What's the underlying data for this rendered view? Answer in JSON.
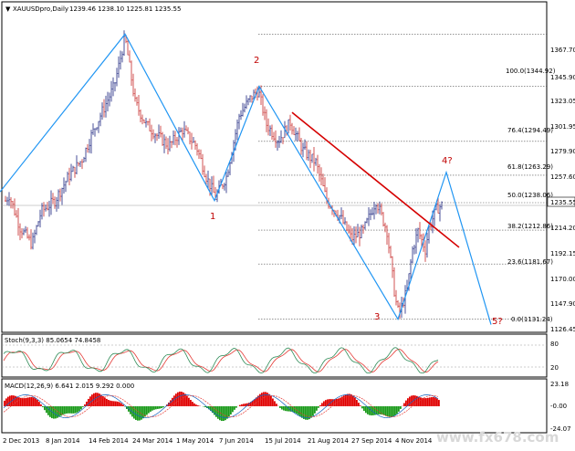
{
  "header": {
    "triangle": "▼",
    "symbol": "XAUUSDpro,Daily",
    "ohlc": "1239.46 1238.10 1225.81 1235.55"
  },
  "price_axis": {
    "ticks": [
      "1367.70",
      "1345.90",
      "1323.05",
      "1301.95",
      "1279.90",
      "1257.60",
      "1235.55",
      "1214.20",
      "1192.15",
      "1170.00",
      "1147.90",
      "1126.45"
    ],
    "current_price": "1235.55"
  },
  "fibonacci": {
    "levels": [
      {
        "label": "100.0(1344.92)"
      },
      {
        "label": "76.4(1294.49)"
      },
      {
        "label": "61.8(1263.29)"
      },
      {
        "label": "50.0(1238.06)"
      },
      {
        "label": "38.2(1212.86)"
      },
      {
        "label": "23.6(1181.67)"
      },
      {
        "label": "0.0(1131.24)"
      }
    ]
  },
  "wave_labels": {
    "w1": "1",
    "w2": "2",
    "w3": "3",
    "w4": "4?",
    "w5": "5?"
  },
  "stoch": {
    "title": "Stoch(9,3,3) 85.0654 74.8458",
    "ticks": [
      "80",
      "20"
    ]
  },
  "macd": {
    "title": "MACD(12,26,9) 6.641 2.015 9.292 0.000",
    "ticks": [
      "23.18",
      "-0.00",
      "-24.07"
    ]
  },
  "time_axis": {
    "labels": [
      "2 Dec 2013",
      "8 Jan 2014",
      "14 Feb 2014",
      "24 Mar 2014",
      "1 May 2014",
      "7 Jun 2014",
      "15 Jul 2014",
      "21 Aug 2014",
      "27 Sep 2014",
      "4 Nov 2014"
    ]
  },
  "watermark": "www.fx678.com",
  "colors": {
    "bull": "#1a237e",
    "bear": "#c62828",
    "wave": "#2196f3",
    "trend": "#d50000",
    "stochK": "#2e8b57",
    "stochD": "#e53935",
    "macdPos": "#e00000",
    "macdNeg": "#1a9a1a"
  }
}
